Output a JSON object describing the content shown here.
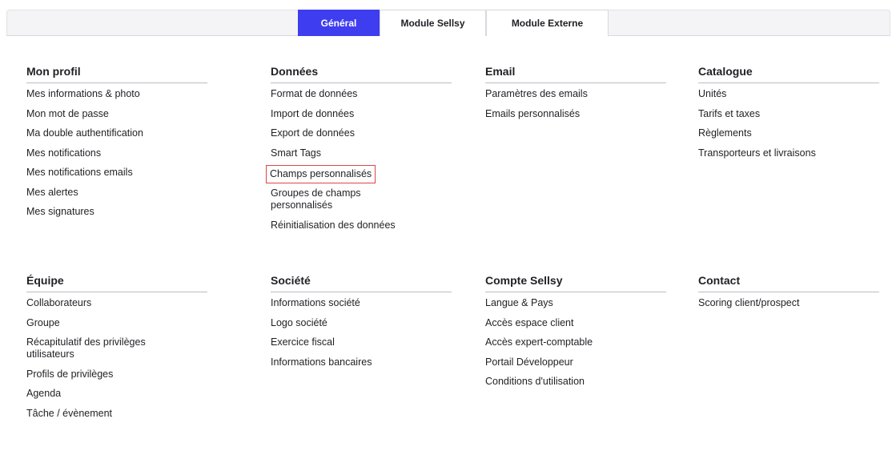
{
  "tabs": [
    {
      "label": "Général",
      "active": true
    },
    {
      "label": "Module Sellsy",
      "active": false
    },
    {
      "label": "Module Externe",
      "active": false
    }
  ],
  "sections": {
    "mon_profil": {
      "title": "Mon profil",
      "items": [
        "Mes informations & photo",
        "Mon mot de passe",
        "Ma double authentification",
        "Mes notifications",
        "Mes notifications emails",
        "Mes alertes",
        "Mes signatures"
      ]
    },
    "donnees": {
      "title": "Données",
      "items": [
        "Format de données",
        "Import de données",
        "Export de données",
        "Smart Tags",
        "Champs personnalisés",
        "Groupes de champs personnalisés",
        "Réinitialisation des données"
      ]
    },
    "email": {
      "title": "Email",
      "items": [
        "Paramètres des emails",
        "Emails personnalisés"
      ]
    },
    "catalogue": {
      "title": "Catalogue",
      "items": [
        "Unités",
        "Tarifs et taxes",
        "Règlements",
        "Transporteurs et livraisons"
      ]
    },
    "equipe": {
      "title": "Équipe",
      "items": [
        "Collaborateurs",
        "Groupe",
        "Récapitulatif des privilèges utilisateurs",
        "Profils de privilèges",
        "Agenda",
        "Tâche / évènement"
      ]
    },
    "societe": {
      "title": "Société",
      "items": [
        "Informations société",
        "Logo société",
        "Exercice fiscal",
        "Informations bancaires"
      ]
    },
    "compte_sellsy": {
      "title": "Compte Sellsy",
      "items": [
        "Langue & Pays",
        "Accès espace client",
        "Accès expert-comptable",
        "Portail Développeur",
        "Conditions d'utilisation"
      ]
    },
    "contact": {
      "title": "Contact",
      "items": [
        "Scoring client/prospect"
      ]
    }
  },
  "colors": {
    "accent": "#3e3ef0",
    "highlight_border": "#e04545"
  }
}
